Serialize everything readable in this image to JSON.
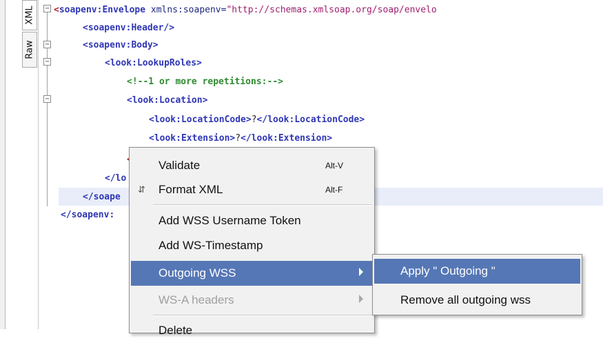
{
  "tabs": {
    "xml": "XML",
    "raw": "Raw"
  },
  "code": {
    "l1_open": "<",
    "l1_tag": "soapenv:Envelope",
    "l1_attr": " xmlns:soapenv=",
    "l1_val": "\"http://schemas.xmlsoap.org/soap/envelo",
    "l2": "<soapenv:Header/>",
    "l3": "<soapenv:Body>",
    "l4": "<look:LookupRoles>",
    "l5": "<!--1 or more repetitions:-->",
    "l6": "<look:Location>",
    "l7_open": "<look:LocationCode>",
    "l7_val": "?",
    "l7_close": "</look:LocationCode>",
    "l8_open": "<look:Extension>",
    "l8_val": "?",
    "l8_close": "</look:Extension>",
    "l9_partial": "<",
    "l10_partial": "</lo",
    "l11_partial": "</soape",
    "l12_partial": "</soapenv:"
  },
  "context_menu": {
    "validate": "Validate",
    "validate_sc": "Alt-V",
    "format_xml": "Format XML",
    "format_xml_sc": "Alt-F",
    "add_wss_token": "Add WSS Username Token",
    "add_ws_timestamp": "Add WS-Timestamp",
    "outgoing_wss": "Outgoing WSS",
    "wsa_headers": "WS-A headers",
    "delete": "Delete"
  },
  "submenu": {
    "apply_outgoing": "Apply \" Outgoing \"",
    "remove_all": "Remove all outgoing wss"
  },
  "colors": {
    "highlight": "#5577b5",
    "menu_bg": "#f1f1f1"
  }
}
